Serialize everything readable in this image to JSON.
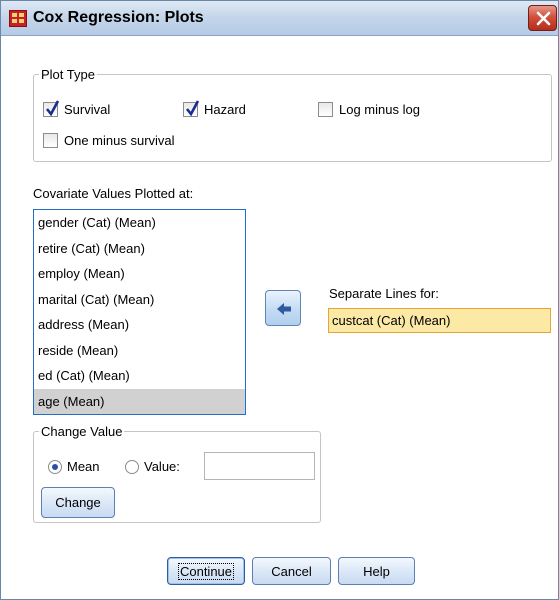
{
  "window": {
    "title": "Cox Regression: Plots"
  },
  "plot_type": {
    "legend": "Plot Type",
    "options": [
      {
        "label": "Survival",
        "checked": true
      },
      {
        "label": "Hazard",
        "checked": true
      },
      {
        "label": "Log minus log",
        "checked": false
      },
      {
        "label": "One minus survival",
        "checked": false
      }
    ]
  },
  "covariates": {
    "label": "Covariate Values Plotted at:",
    "items": [
      "gender (Cat) (Mean)",
      "retire (Cat) (Mean)",
      "employ (Mean)",
      "marital (Cat) (Mean)",
      "address (Mean)",
      "reside (Mean)",
      "ed (Cat) (Mean)",
      "age (Mean)"
    ],
    "selected_index": 7
  },
  "separate_lines": {
    "label": "Separate Lines for:",
    "value": "custcat (Cat) (Mean)"
  },
  "change_value": {
    "legend": "Change Value",
    "mean_label": "Mean",
    "value_label": "Value:",
    "selected": "Mean",
    "value": "",
    "change_button": "Change"
  },
  "buttons": {
    "continue": "Continue",
    "cancel": "Cancel",
    "help": "Help"
  },
  "icons": [
    "dialog-app-icon",
    "close-icon",
    "move-arrow-icon"
  ]
}
